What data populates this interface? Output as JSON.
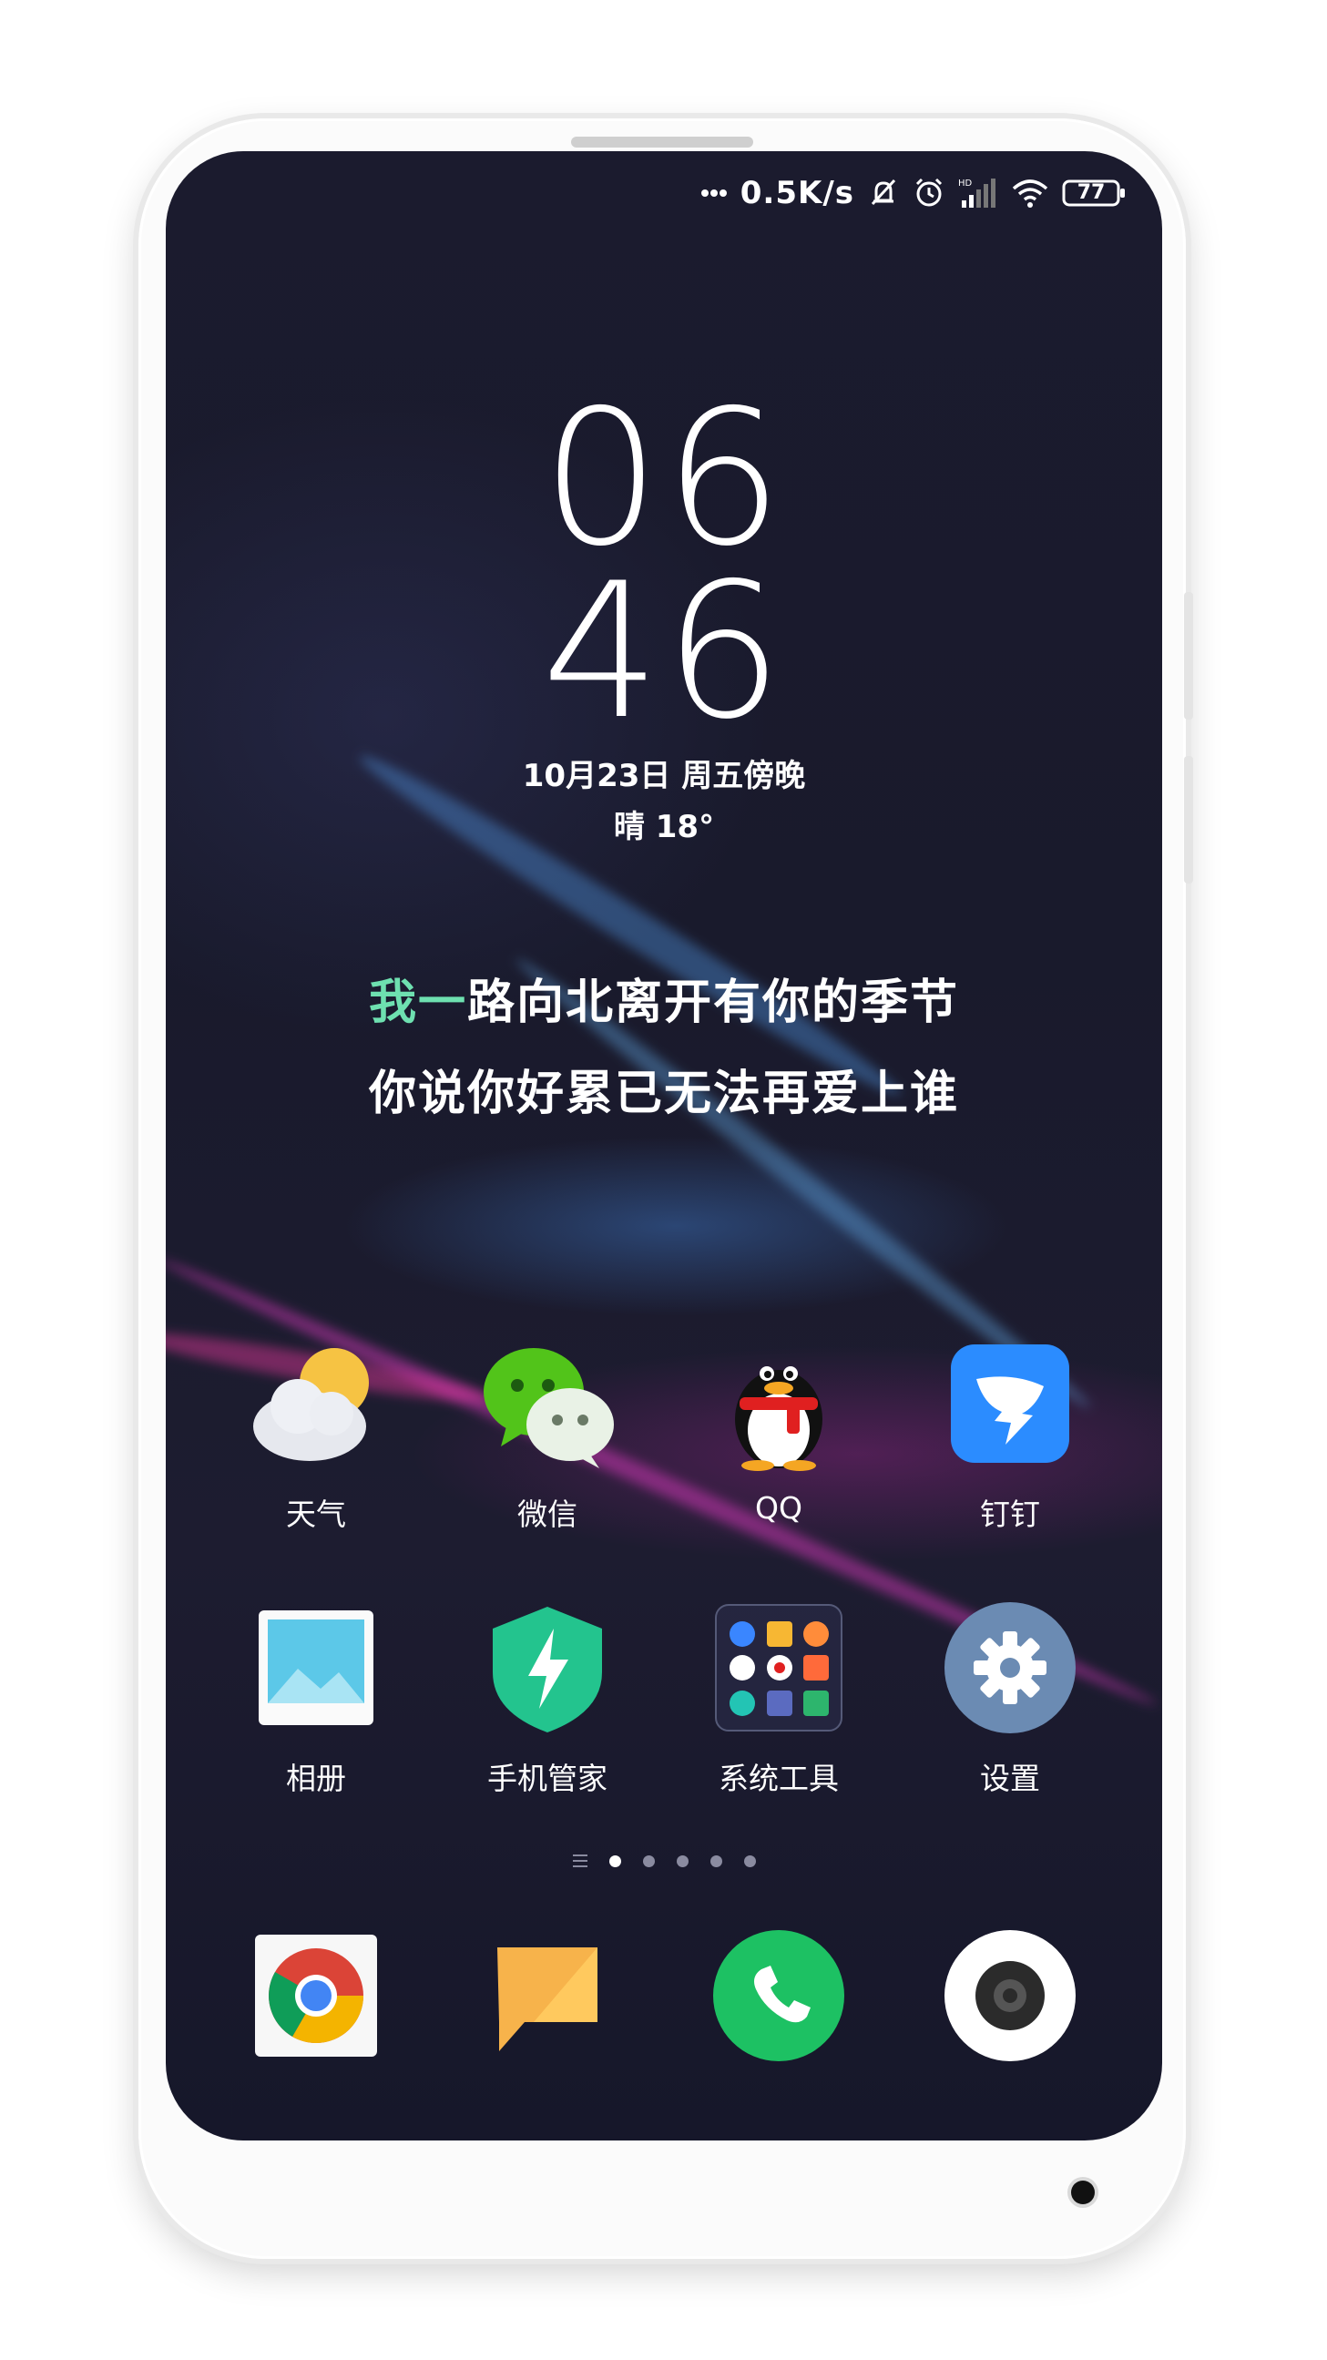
{
  "status_bar": {
    "network_speed": "0.5K/s",
    "battery": "77",
    "signal_label": "HD",
    "icons": [
      "more-dots-icon",
      "mute-bell-icon",
      "alarm-icon",
      "cellular-signal-icon",
      "wifi-icon",
      "battery-icon"
    ]
  },
  "lockclock": {
    "hour": "06",
    "minute": "46",
    "date": "10月23日 周五傍晚",
    "weather": "晴  18°"
  },
  "lyrics": {
    "line1_highlight": "我一",
    "line1_rest": "路向北离开有你的季节",
    "line2": "你说你好累已无法再爱上谁"
  },
  "apps_row1": [
    {
      "label": "天气",
      "icon": "weather-icon"
    },
    {
      "label": "微信",
      "icon": "wechat-icon"
    },
    {
      "label": "QQ",
      "icon": "qq-penguin-icon"
    },
    {
      "label": "钉钉",
      "icon": "dingtalk-icon"
    }
  ],
  "apps_row2": [
    {
      "label": "相册",
      "icon": "gallery-icon"
    },
    {
      "label": "手机管家",
      "icon": "security-shield-icon"
    },
    {
      "label": "系统工具",
      "icon": "system-tools-folder-icon"
    },
    {
      "label": "设置",
      "icon": "settings-gear-icon"
    }
  ],
  "page_indicator": {
    "pages": 5,
    "active": 1
  },
  "dock": [
    "chrome-icon",
    "messages-icon",
    "phone-icon",
    "camera-icon"
  ],
  "colors": {
    "wallpaper": "#1b1b2e",
    "lyric_highlight": "#6ee0b0",
    "phone_green": "#1dc163",
    "dingtalk_blue": "#2b8cff",
    "settings_gray": "#6b8bb3"
  }
}
